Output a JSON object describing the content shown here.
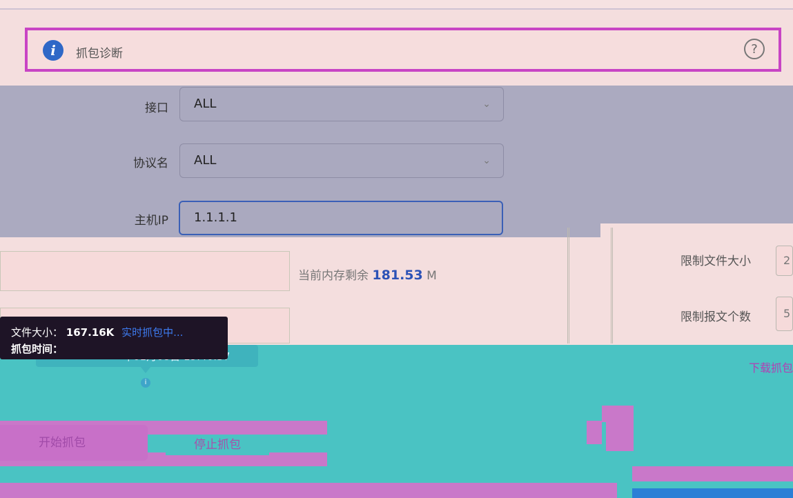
{
  "header": {
    "title": "抓包诊断",
    "info_icon": "info-icon",
    "help_icon": "help-icon",
    "help_glyph": "?"
  },
  "form": {
    "interface": {
      "label": "接口",
      "value": "ALL"
    },
    "protocol": {
      "label": "协议名",
      "value": "ALL"
    },
    "host_ip": {
      "label": "主机IP",
      "value": "1.1.1.1"
    }
  },
  "memory": {
    "prefix": "当前内存剩余",
    "value": "181.53",
    "unit": "M"
  },
  "limits": {
    "file_size_label": "限制文件大小",
    "file_size_value": "2",
    "packet_count_label": "限制报文个数",
    "packet_count_value": "5"
  },
  "tooltip": {
    "file_size_label": "文件大小：",
    "file_size_value": "167.16K",
    "status": "实时抓包中...",
    "time_label": "抓包时间：",
    "time_value": "年01月08日 19:40:37"
  },
  "actions": {
    "start_label": "开始抓包",
    "stop_label": "停止抓包",
    "download_label": "下载抓包"
  },
  "colors": {
    "accent": "#2c52b6",
    "teal": "#4ac3c3",
    "magenta": "#c844c4"
  }
}
